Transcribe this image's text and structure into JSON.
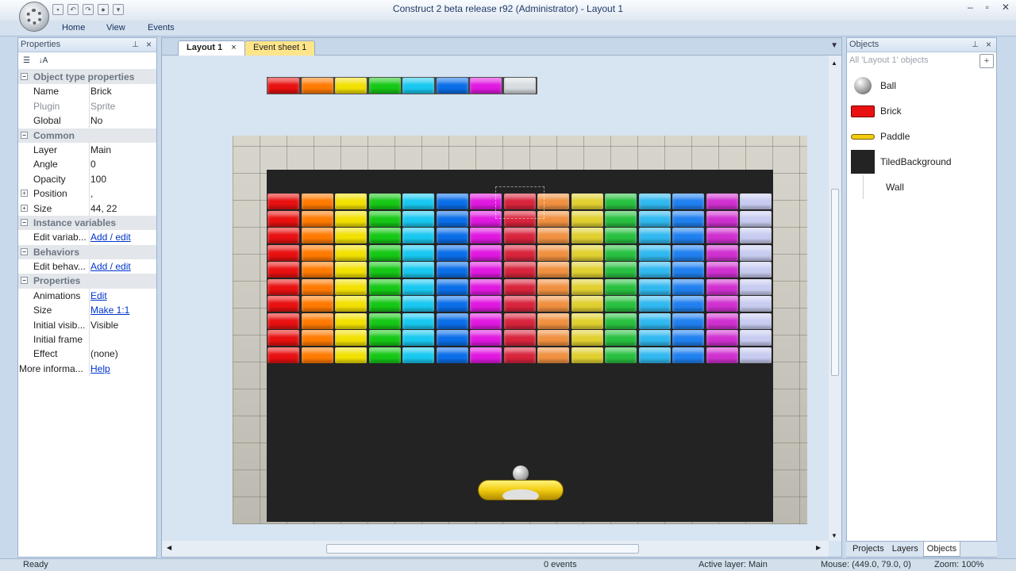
{
  "window": {
    "title": "Construct 2 beta release r92 (Administrator) - Layout 1",
    "controls": [
      "–",
      "▫",
      "✕"
    ]
  },
  "ribbon": {
    "tabs": [
      "Home",
      "View",
      "Events"
    ]
  },
  "properties_panel": {
    "title": "Properties",
    "rows": [
      {
        "type": "cat",
        "label": "Object type properties"
      },
      {
        "label": "Name",
        "value": "Brick"
      },
      {
        "label": "Plugin",
        "value": "Sprite",
        "dim": true
      },
      {
        "label": "Global",
        "value": "No"
      },
      {
        "type": "cat",
        "label": "Common"
      },
      {
        "label": "Layer",
        "value": "Main"
      },
      {
        "label": "Angle",
        "value": "0"
      },
      {
        "label": "Opacity",
        "value": "100"
      },
      {
        "label": "Position",
        "value": ",",
        "expand": true
      },
      {
        "label": "Size",
        "value": "44, 22",
        "expand": true
      },
      {
        "type": "cat",
        "label": "Instance variables"
      },
      {
        "label": "Edit variab...",
        "value": "Add / edit",
        "link": true
      },
      {
        "type": "cat",
        "label": "Behaviors"
      },
      {
        "label": "Edit behav...",
        "value": "Add / edit",
        "link": true
      },
      {
        "type": "cat",
        "label": "Properties"
      },
      {
        "label": "Animations",
        "value": "Edit",
        "link": true
      },
      {
        "label": "Size",
        "value": "Make 1:1",
        "link": true
      },
      {
        "label": "Initial visib...",
        "value": "Visible"
      },
      {
        "label": "Initial frame",
        "value": ""
      },
      {
        "label": "Effect",
        "value": "(none)"
      },
      {
        "label": "More informa...",
        "value": "Help",
        "link": true,
        "noindent": true
      }
    ]
  },
  "document_tabs": [
    {
      "label": "Layout 1",
      "close": "×"
    },
    {
      "label": "Event sheet 1"
    }
  ],
  "objects_panel": {
    "title": "Objects",
    "filter": "All 'Layout 1' objects",
    "items": [
      "Ball",
      "Brick",
      "Paddle",
      "TiledBackground",
      "Wall"
    ]
  },
  "bottom_tabs": [
    "Projects",
    "Layers",
    "Objects"
  ],
  "status": {
    "ready": "Ready",
    "events": "0 events",
    "active_layer": "Active layer: Main",
    "mouse": "Mouse: (449.0, 79.0, 0)",
    "zoom": "Zoom: 100%"
  },
  "colors": {
    "bricks": [
      "#e81010",
      "#ff7a00",
      "#f2e000",
      "#16c816",
      "#18c8f0",
      "#0a6ee8",
      "#e018e0",
      "#d8243c",
      "#f09040",
      "#e0d030",
      "#28c040",
      "#30b8f0",
      "#2080f0",
      "#d030d0",
      "#c8ccf0"
    ],
    "palette_bricks": [
      "#e81010",
      "#ff7a00",
      "#f2e000",
      "#16c816",
      "#18c8f0",
      "#0a6ee8",
      "#e018e0",
      "#d8dce0"
    ],
    "paddle": "#f2cc10"
  }
}
